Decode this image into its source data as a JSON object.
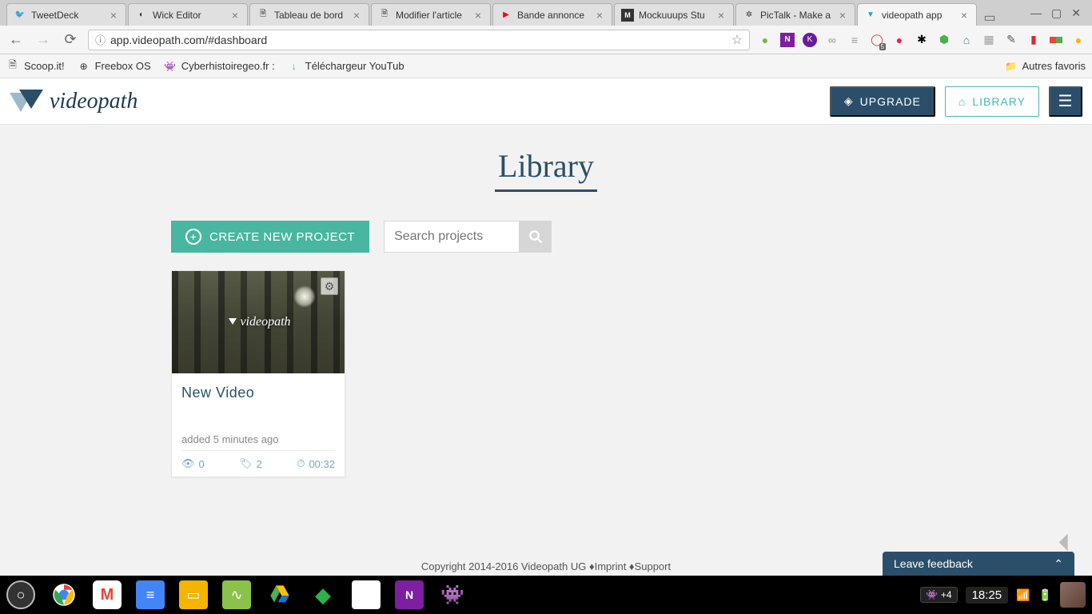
{
  "browser": {
    "tabs": [
      {
        "title": "TweetDeck",
        "favicon_color": "#1da1f2",
        "favicon_char": "🐦"
      },
      {
        "title": "Wick Editor",
        "favicon_color": "#333",
        "favicon_char": "○"
      },
      {
        "title": "Tableau de bord",
        "favicon_color": "#888",
        "favicon_char": "🗎"
      },
      {
        "title": "Modifier l'article",
        "favicon_color": "#888",
        "favicon_char": "🗎"
      },
      {
        "title": "Bande annonce",
        "favicon_color": "#f00",
        "favicon_char": "▶"
      },
      {
        "title": "Mockuuups Stu",
        "favicon_color": "#333",
        "favicon_char": "M"
      },
      {
        "title": "PicTalk - Make a",
        "favicon_color": "#888",
        "favicon_char": "✲"
      },
      {
        "title": "videopath app",
        "favicon_color": "#2b9fd6",
        "favicon_char": "▼",
        "active": true
      }
    ],
    "url": "app.videopath.com/#dashboard",
    "bookmarks": [
      {
        "label": "Scoop.it!",
        "icon": ""
      },
      {
        "label": "Freebox OS",
        "icon": "⊕"
      },
      {
        "label": "Cyberhistoiregeo.fr :",
        "icon": "👾"
      },
      {
        "label": "Téléchargeur YouTub",
        "icon": "↓"
      }
    ],
    "bookmarks_other": "Autres favoris",
    "ext_colors": [
      "#7cb342",
      "#7e57c2",
      "#6a1b9a",
      "#999",
      "#999",
      "#e53935",
      "#e91e63",
      "#000",
      "#4caf50",
      "#607d8b",
      "#9e9e9e",
      "#795548",
      "#f44336",
      "#2196f3",
      "#ffb300"
    ]
  },
  "app": {
    "logo_text": "videopath",
    "upgrade_label": "UPGRADE",
    "library_label": "LIBRARY",
    "page_title": "Library",
    "create_label": "CREATE NEW PROJECT",
    "search_placeholder": "Search projects",
    "project": {
      "title": "New Video",
      "added": "added 5 minutes ago",
      "views": "0",
      "markers": "2",
      "duration": "00:32"
    },
    "footer": "Copyright 2014-2016 Videopath UG ♦Imprint ♦Support",
    "feedback_label": "Leave feedback"
  },
  "system": {
    "tray_count": "+4",
    "clock": "18:25"
  }
}
